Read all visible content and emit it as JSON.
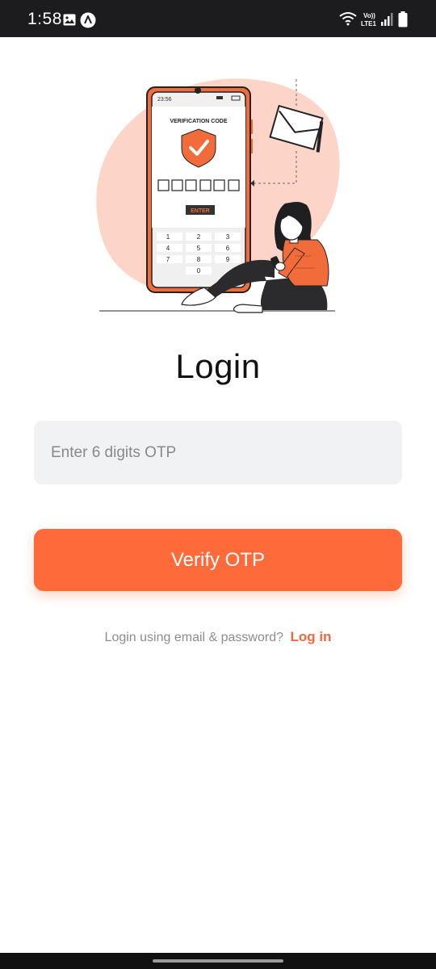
{
  "status_bar": {
    "time": "1:58",
    "network_label_top": "Vo))",
    "network_label_bottom": "LTE1",
    "icons": [
      "gallery-icon",
      "app-icon",
      "wifi-icon",
      "volte-icon",
      "signal-icon",
      "battery-icon"
    ]
  },
  "illustration": {
    "phone_time": "23:56",
    "verification_title": "VERIFICATION CODE",
    "enter_label": "ENTER",
    "keypad": [
      "1",
      "2",
      "3",
      "4",
      "5",
      "6",
      "7",
      "8",
      "9",
      "0"
    ],
    "accent_color": "#f26b3a",
    "blob_color": "#fdd5c8"
  },
  "page": {
    "title": "Login"
  },
  "otp_field": {
    "placeholder": "Enter 6 digits OTP",
    "value": ""
  },
  "verify_button": {
    "label": "Verify OTP",
    "color": "#fe6a3a"
  },
  "alt_login": {
    "prompt": "Login using email & password?",
    "link_label": "Log in"
  }
}
